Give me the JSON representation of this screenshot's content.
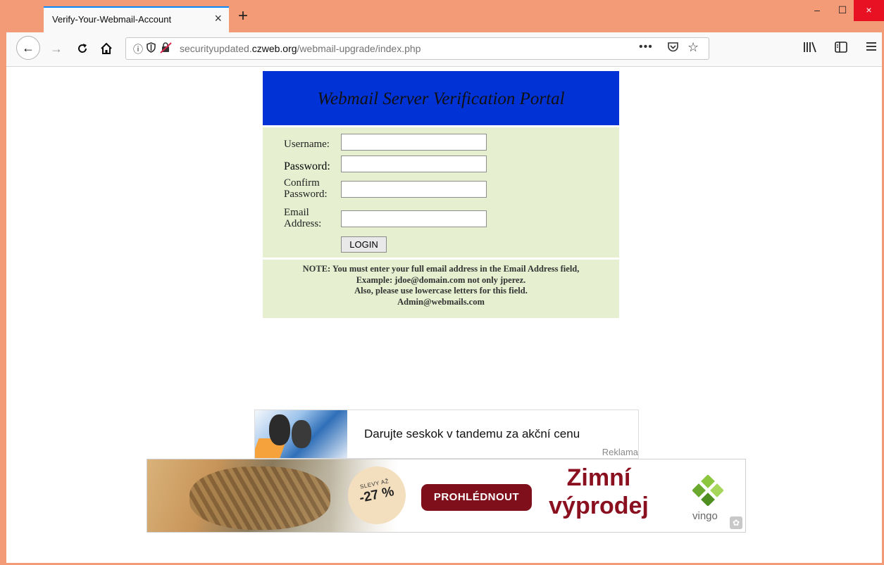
{
  "window": {
    "tab_title": "Verify-Your-Webmail-Account",
    "tab_close": "×",
    "new_tab": "+",
    "minimize": "–",
    "maximize": "☐",
    "close": "×"
  },
  "navbar": {
    "back": "←",
    "forward": "→",
    "reload": "C",
    "home": "⌂",
    "url_prefix": "securityupdated.",
    "url_domain": "czweb.org",
    "url_path": "/webmail-upgrade/index.php",
    "more": "•••"
  },
  "portal": {
    "title": "Webmail Server Verification Portal",
    "labels": {
      "username": "Username:",
      "password": "Password:",
      "confirm_1": "Confirm",
      "confirm_2": "Password:",
      "email_1": "Email",
      "email_2": "Address:"
    },
    "login_button": "LOGIN",
    "note_lines": [
      "NOTE: You must enter your full email address in the Email Address field,",
      "Example: jdoe@domain.com not only jperez.",
      "Also, please use lowercase letters for this field.",
      "Admin@webmails.com"
    ]
  },
  "ads": {
    "ad1": {
      "text": "Darujte seskok v tandemu za akční cenu",
      "tag": "Reklama"
    },
    "ad2": {
      "badge_small": "SLEVY AŽ",
      "badge_big": "-27 %",
      "cta": "PROHLÉDNOUT",
      "headline_1": "Zimní",
      "headline_2": "výprodej",
      "brand": "vingo"
    }
  },
  "colors": {
    "window_frame": "#f39a76",
    "portal_header": "#0032d6",
    "portal_body": "#e6efd0",
    "cta": "#7f0f1a",
    "headline": "#8a0f1f"
  }
}
